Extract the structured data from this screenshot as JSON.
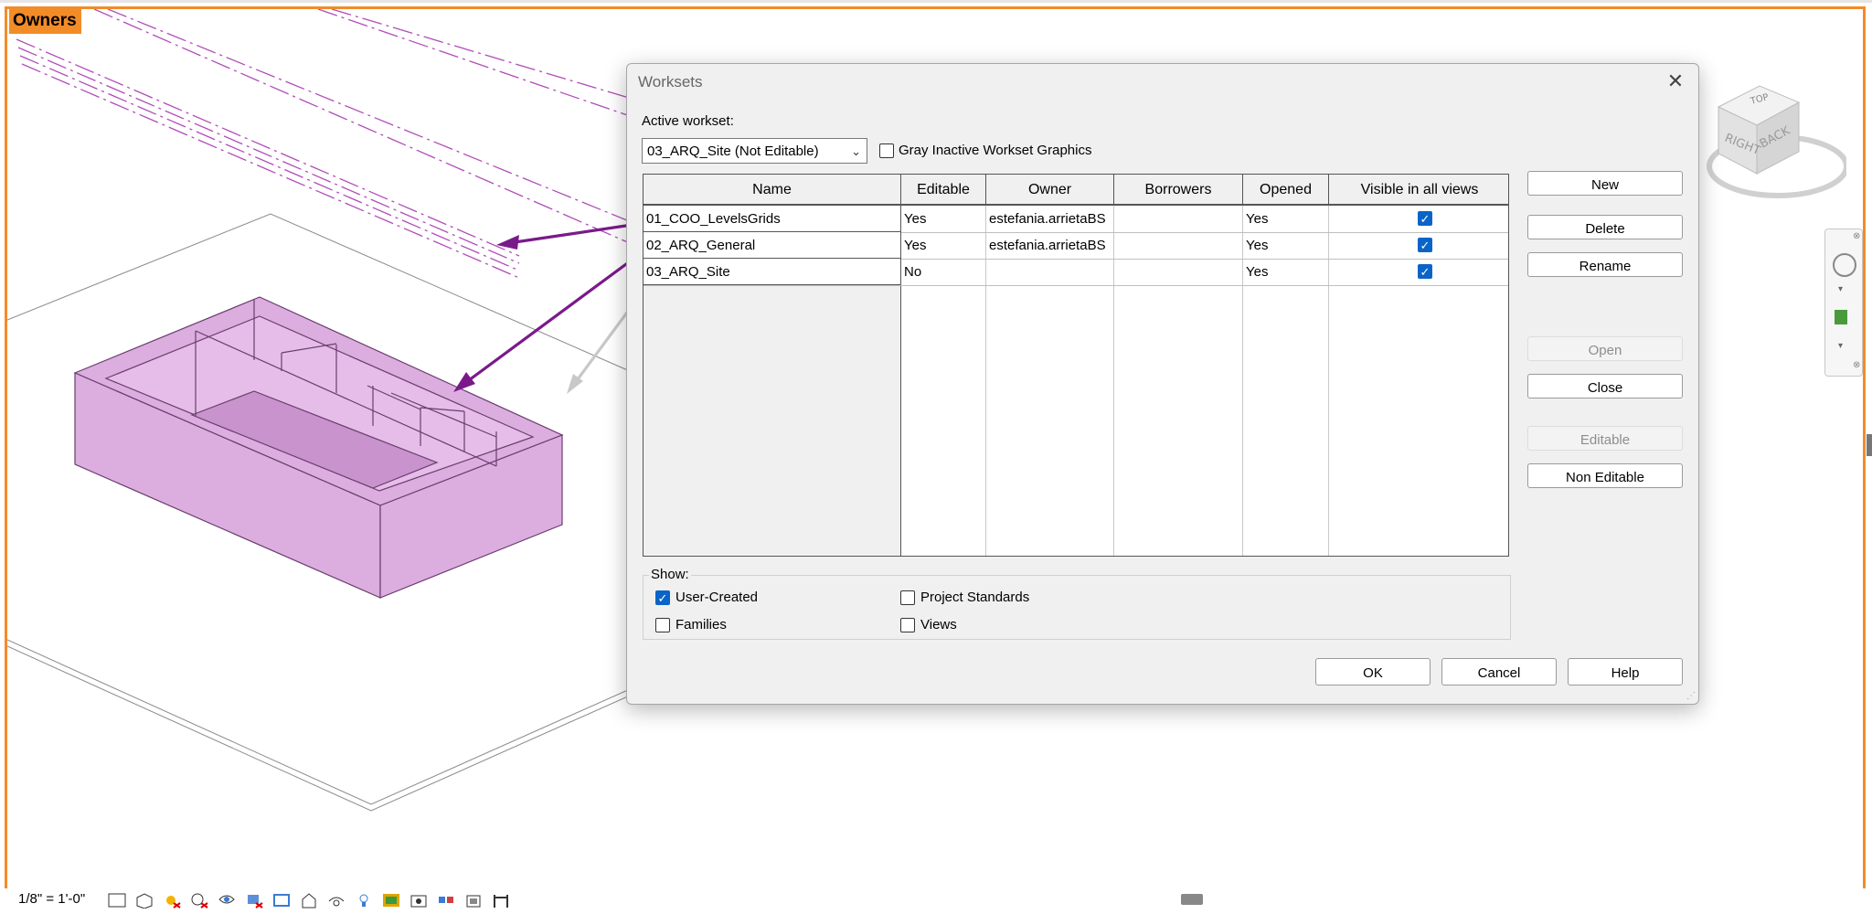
{
  "view": {
    "label": "Owners",
    "scale": "1/8\" = 1'-0\"",
    "viewcube_faces": {
      "top": "TOP",
      "right": "RIGHT",
      "back": "BACK"
    }
  },
  "dialog": {
    "title": "Worksets",
    "active_workset_label": "Active workset:",
    "active_workset_value": "03_ARQ_Site (Not Editable)",
    "gray_inactive_label": "Gray Inactive Workset Graphics",
    "gray_inactive_checked": false,
    "columns": [
      "Name",
      "Editable",
      "Owner",
      "Borrowers",
      "Opened",
      "Visible in all views"
    ],
    "rows": [
      {
        "name": "01_COO_LevelsGrids",
        "editable": "Yes",
        "owner": "estefania.arrietaBS",
        "borrowers": "",
        "opened": "Yes",
        "visible": true
      },
      {
        "name": "02_ARQ_General",
        "editable": "Yes",
        "owner": "estefania.arrietaBS",
        "borrowers": "",
        "opened": "Yes",
        "visible": true
      },
      {
        "name": "03_ARQ_Site",
        "editable": "No",
        "owner": "",
        "borrowers": "",
        "opened": "Yes",
        "visible": true
      }
    ],
    "side_buttons": {
      "new": "New",
      "delete": "Delete",
      "rename": "Rename",
      "open": "Open",
      "close": "Close",
      "editable": "Editable",
      "non_editable": "Non Editable"
    },
    "show": {
      "label": "Show:",
      "user_created": {
        "label": "User-Created",
        "checked": true
      },
      "families": {
        "label": "Families",
        "checked": false
      },
      "project_standards": {
        "label": "Project Standards",
        "checked": false
      },
      "views": {
        "label": "Views",
        "checked": false
      }
    },
    "footer_buttons": {
      "ok": "OK",
      "cancel": "Cancel",
      "help": "Help"
    }
  },
  "colors": {
    "view_border": "#f28c28",
    "element_fill": "#dcaee0",
    "arrow": "#7a1a8a",
    "checkbox_blue": "#0a64c8"
  }
}
